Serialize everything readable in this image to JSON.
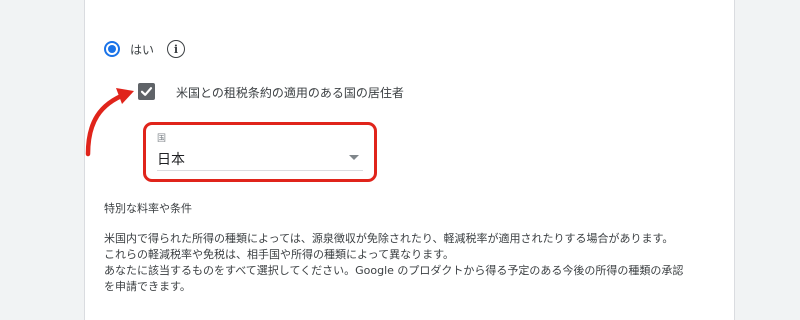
{
  "form": {
    "radio_label": "はい",
    "checkbox_label": "米国との租税条約の適用のある国の居住者",
    "country_caption": "国",
    "country_value": "日本"
  },
  "rates": {
    "title": "特別な料率や条件",
    "lines": [
      "米国内で得られた所得の種類によっては、源泉徴収が免除されたり、軽減税率が適用されたりする場合があります。",
      "これらの軽減税率や免税は、相手国や所得の種類によって異なります。",
      "あなたに該当するものをすべて選択してください。Google のプロダクトから得る予定のある今後の所得の種類の承認",
      "を申請できます。"
    ]
  },
  "colors": {
    "radio_accent": "#1a73e8",
    "checkbox_fill": "#5f6368",
    "annotation_red": "#e0241b"
  },
  "icons": {
    "info": "info-circle-icon",
    "check": "check-icon",
    "dropdown": "triangle-down-icon",
    "annotation": "curved-arrow-icon"
  }
}
